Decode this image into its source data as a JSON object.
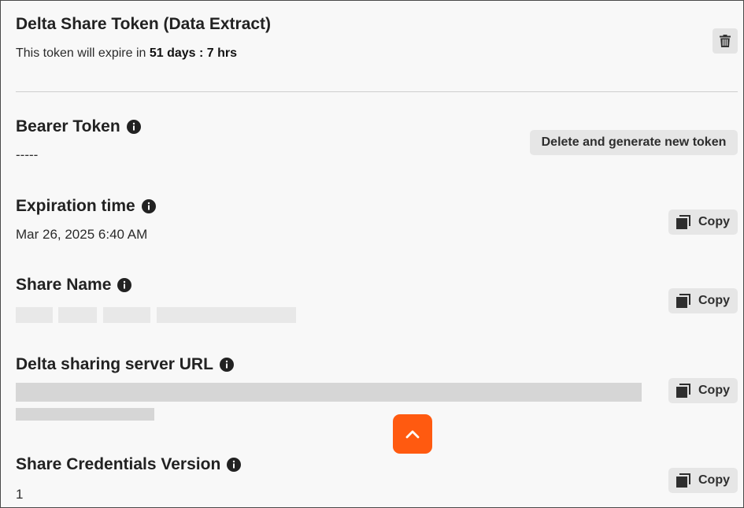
{
  "header": {
    "title": "Delta Share Token (Data Extract)",
    "expiry_prefix": "This token will expire in ",
    "expiry_value": "51 days : 7 hrs"
  },
  "bearer_token": {
    "label": "Bearer Token",
    "value": "-----",
    "regenerate_label": "Delete and generate new token"
  },
  "expiration_time": {
    "label": "Expiration time",
    "value": "Mar 26, 2025 6:40 AM",
    "copy_label": "Copy"
  },
  "share_name": {
    "label": "Share Name",
    "copy_label": "Copy"
  },
  "server_url": {
    "label": "Delta sharing server URL",
    "copy_label": "Copy"
  },
  "credentials_version": {
    "label": "Share Credentials Version",
    "value": "1",
    "copy_label": "Copy"
  },
  "colors": {
    "accent": "#ff5a10",
    "button_bg": "#e6e6e6",
    "panel_bg": "#f8f8f8"
  },
  "icons": {
    "delete": "trash-icon",
    "info": "info-icon",
    "copy": "copy-icon",
    "scroll_top": "chevron-up-icon"
  }
}
